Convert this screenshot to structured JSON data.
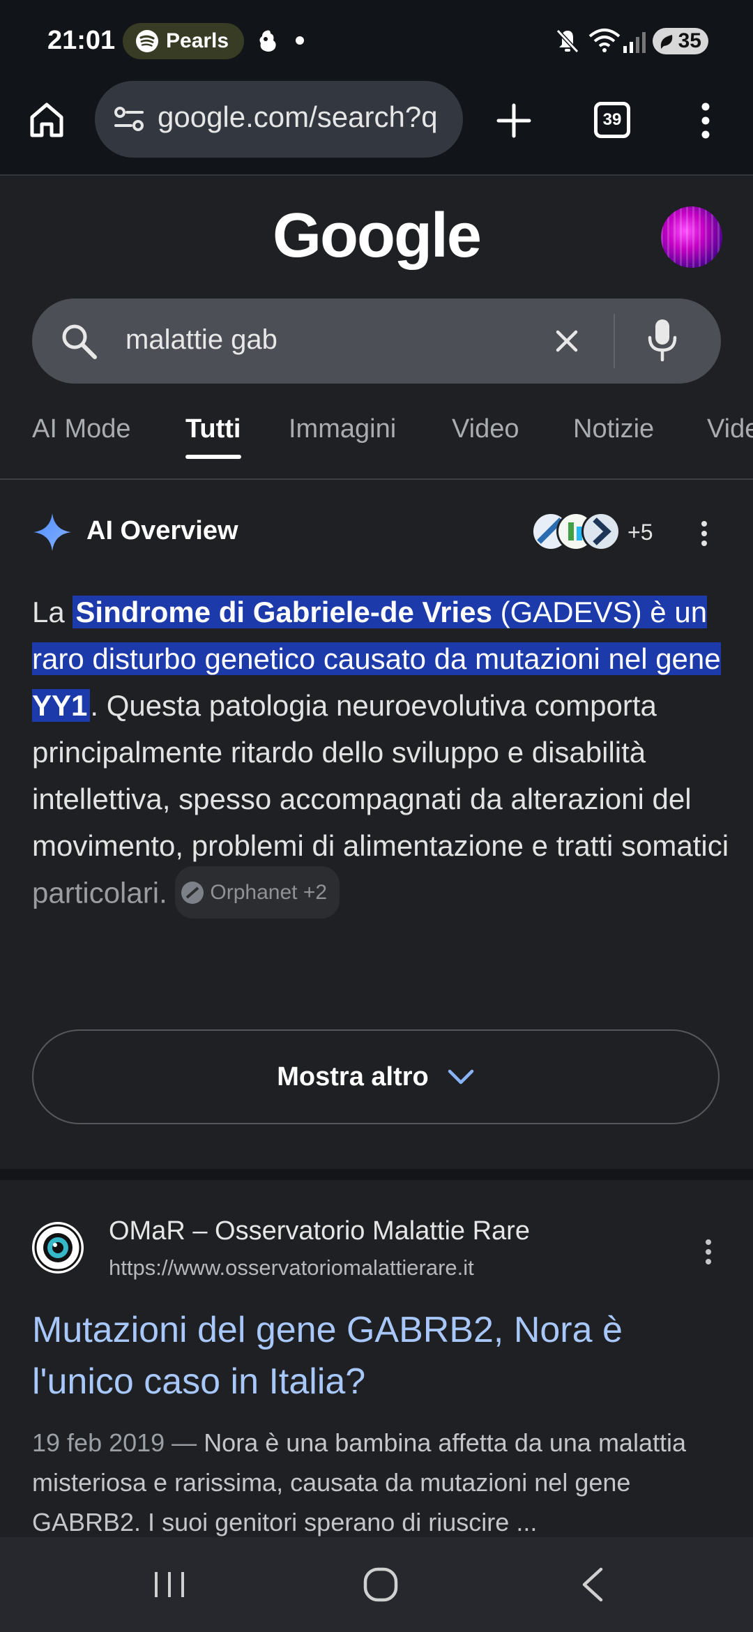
{
  "status_bar": {
    "time": "21:01",
    "music_pill": "Pearls",
    "battery": "35"
  },
  "browser": {
    "url": "google.com/search?q",
    "tab_count": "39"
  },
  "search": {
    "logo": "Google",
    "query": "malattie gab"
  },
  "tabs": [
    "AI Mode",
    "Tutti",
    "Immagini",
    "Video",
    "Notizie",
    "Vide"
  ],
  "active_tab": "Tutti",
  "ai_overview": {
    "title": "AI Overview",
    "sources_more": "+5",
    "text_prefix": "La ",
    "highlight_1": "Sindrome di Gabriele-de Vries",
    "highlight_2": " (GADEVS) è un raro disturbo genetico causato da mutazioni nel gene ",
    "highlight_3": "YY1",
    "text_rest": ". Questa patologia neuroevolutiva comporta principalmente ritardo dello sviluppo e disabilità intellettiva, spesso accompagnati da alterazioni del movimento, problemi di alimentazione e tratti somatici",
    "text_faded": "particolari.",
    "citation": "Orphanet +2",
    "more_label": "Mostra altro"
  },
  "result": {
    "site_name": "OMaR – Osservatorio Malattie Rare",
    "site_url": "https://www.osservatoriomalattierare.it",
    "title": "Mutazioni del gene GABRB2, Nora è l'unico caso in Italia?",
    "date": "19 feb 2019 — ",
    "snippet": "Nora è una bambina affetta da una malattia misteriosa e rarissima, causata da mutazioni nel gene GABRB2. I suoi genitori sperano di riuscire ..."
  },
  "colors": {
    "background": "#1f2023",
    "link": "#a8c7fa",
    "highlight": "#1c3aa9"
  },
  "icons": [
    "spotify-icon",
    "home-icon",
    "site-settings-icon",
    "new-tab-icon",
    "tabs-icon",
    "overflow-menu-icon",
    "search-icon",
    "clear-icon",
    "mic-icon",
    "ai-sparkle-icon",
    "chevron-down-icon",
    "recent-apps-icon",
    "home-circle-icon",
    "back-icon"
  ]
}
